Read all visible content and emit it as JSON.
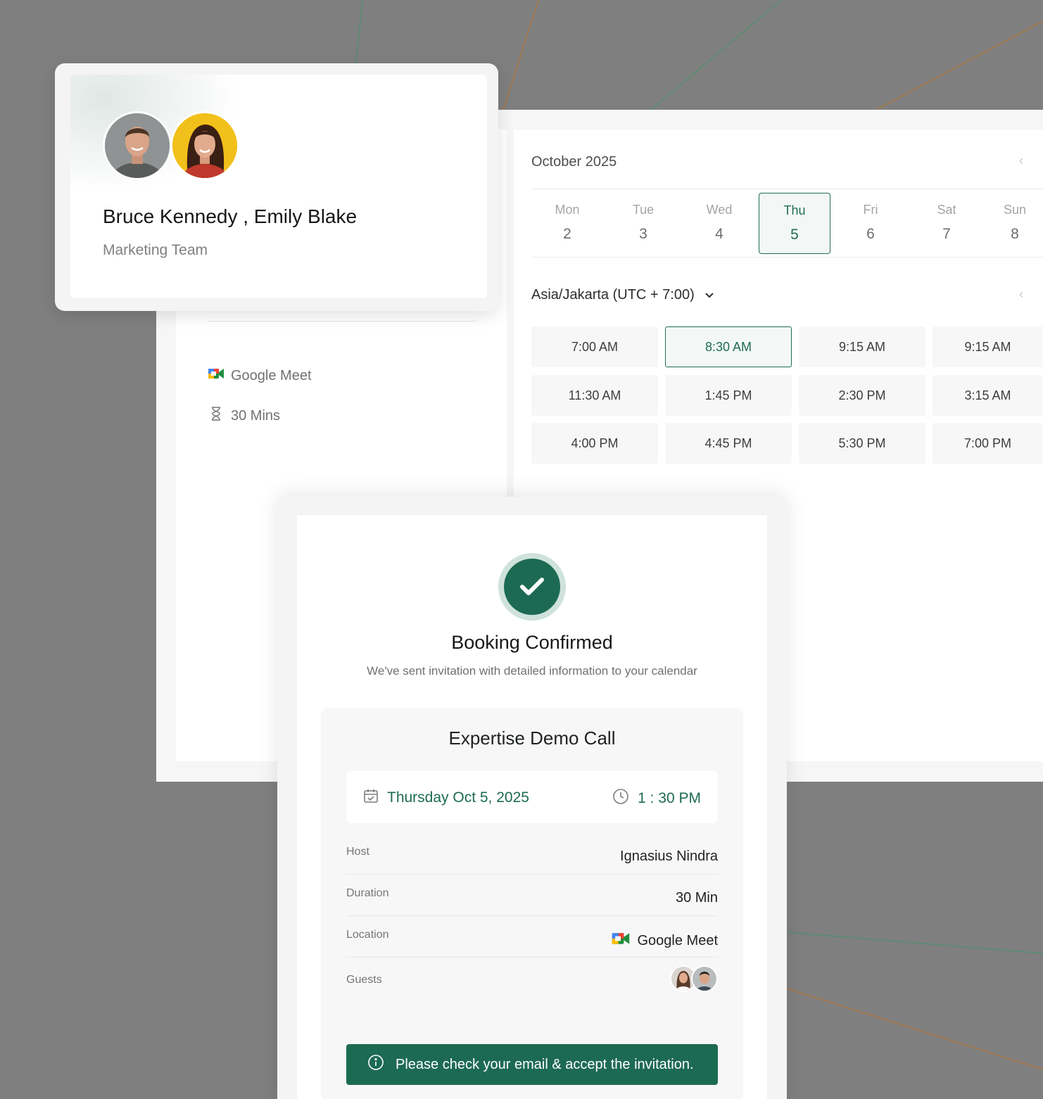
{
  "scheduler": {
    "month": "October 2025",
    "days": [
      {
        "name": "Mon",
        "num": "2"
      },
      {
        "name": "Tue",
        "num": "3"
      },
      {
        "name": "Wed",
        "num": "4"
      },
      {
        "name": "Thu",
        "num": "5",
        "selected": true
      },
      {
        "name": "Fri",
        "num": "6"
      },
      {
        "name": "Sat",
        "num": "7"
      },
      {
        "name": "Sun",
        "num": "8"
      }
    ],
    "timezone": "Asia/Jakarta (UTC + 7:00)",
    "slots": [
      "7:00 AM",
      "8:30 AM",
      "9:15 AM",
      "9:15 AM",
      "11:30 AM",
      "1:45 PM",
      "2:30 PM",
      "3:15 AM",
      "4:00 PM",
      "4:45 PM",
      "5:30 PM",
      "7:00 PM"
    ],
    "selected_slot": "8:30 AM",
    "meeting_platform": "Google Meet",
    "duration": "30 Mins"
  },
  "profile": {
    "names": "Bruce Kennedy , Emily Blake",
    "team": "Marketing Team"
  },
  "confirmation": {
    "title": "Booking Confirmed",
    "subtitle": "We've sent invitation with detailed information to your calendar",
    "event_title": "Expertise Demo Call",
    "date": "Thursday Oct 5, 2025",
    "time": "1 : 30 PM",
    "details": {
      "host_label": "Host",
      "host_value": "Ignasius Nindra",
      "duration_label": "Duration",
      "duration_value": "30 Min",
      "location_label": "Location",
      "location_value": "Google Meet",
      "guests_label": "Guests"
    },
    "notice": "Please check your email & accept the invitation."
  },
  "colors": {
    "accent": "#1d6a53",
    "background": "#7f7f7f"
  },
  "icons": [
    "google-meet-icon",
    "hourglass-icon",
    "chevron-left-icon",
    "chevron-down-icon",
    "checkmark-icon",
    "calendar-icon",
    "clock-icon",
    "info-icon"
  ]
}
